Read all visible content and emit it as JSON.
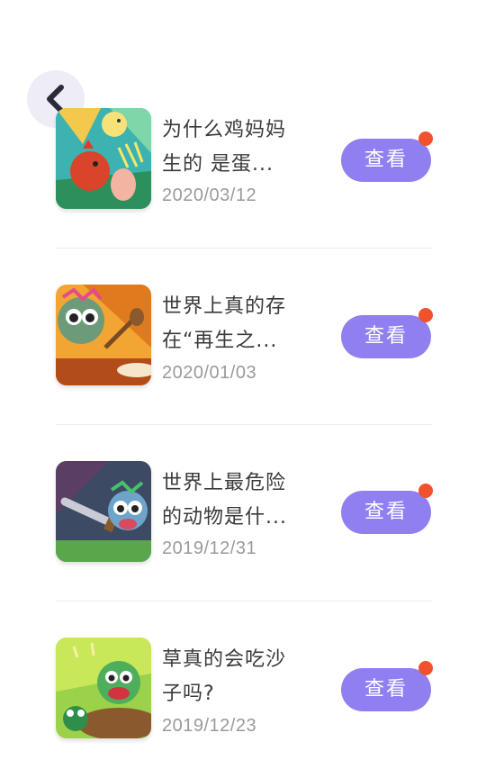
{
  "header": {
    "back_icon": "chevron-left-icon"
  },
  "colors": {
    "button": "#8f7ff0",
    "badge": "#f2512d",
    "title_text": "#3a3a3a",
    "date_text": "#9a9a9a"
  },
  "items": [
    {
      "title": "为什么鸡妈妈生的 是蛋...",
      "date": "2020/03/12",
      "button_label": "查看",
      "unread_badge": true,
      "thumbnail": "hen-and-chick-illustration"
    },
    {
      "title": "世界上真的存在“再生之...",
      "date": "2020/01/03",
      "button_label": "查看",
      "unread_badge": true,
      "thumbnail": "cartoon-creature-with-shovel-illustration"
    },
    {
      "title": "世界上最危险的动物是什...",
      "date": "2019/12/31",
      "button_label": "查看",
      "unread_badge": true,
      "thumbnail": "cartoon-creature-with-sword-illustration"
    },
    {
      "title": "草真的会吃沙子吗?",
      "date": "2019/12/23",
      "button_label": "查看",
      "unread_badge": true,
      "thumbnail": "green-monster-and-frog-illustration"
    }
  ]
}
